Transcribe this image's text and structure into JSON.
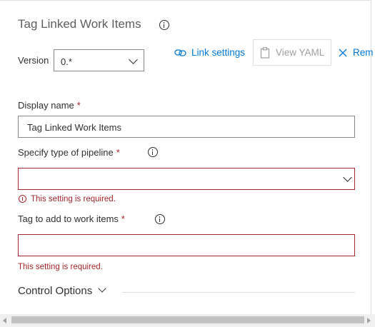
{
  "task": {
    "title": "Tag Linked Work Items",
    "version_label": "Version",
    "version_value": "0.*"
  },
  "toolbar": {
    "link_settings": "Link settings",
    "view_yaml": "View YAML",
    "remove": "Rem"
  },
  "fields": {
    "display_name": {
      "label": "Display name",
      "required": "*",
      "value": "Tag Linked Work Items"
    },
    "pipeline_type": {
      "label": "Specify type of pipeline",
      "required": "*",
      "value": "",
      "error": "This setting is required."
    },
    "tag": {
      "label": "Tag to add to work items",
      "required": "*",
      "value": "",
      "error": "This setting is required."
    }
  },
  "control_options": {
    "label": "Control Options"
  },
  "colors": {
    "accent": "#0078d4",
    "error": "#a4262c",
    "border": "#8a8886"
  }
}
